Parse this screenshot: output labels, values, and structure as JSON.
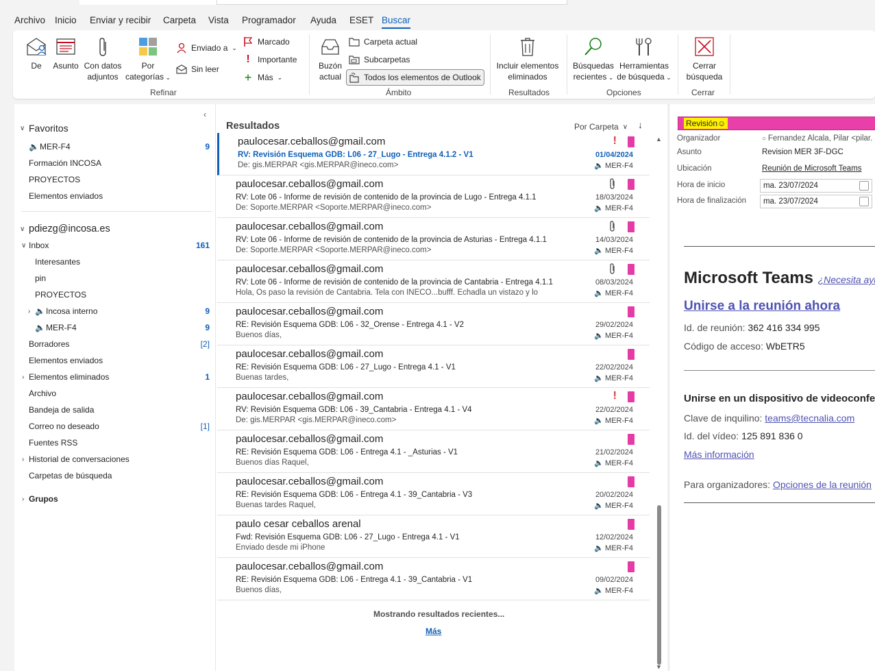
{
  "menu": {
    "tabs": [
      "Archivo",
      "Inicio",
      "Enviar y recibir",
      "Carpeta",
      "Vista",
      "Programador",
      "Ayuda",
      "ESET",
      "Buscar"
    ]
  },
  "ribbon": {
    "from_label": "De",
    "subject_label": "Asunto",
    "attachments_label": "Con datos adjuntos",
    "categories_label": "Por categorías",
    "sent_to_label": "Enviado a",
    "unread_label": "Sin leer",
    "flagged_label": "Marcado",
    "important_label": "Importante",
    "more_label": "Más",
    "refine_group": "Refinar",
    "current_mailbox_label": "Buzón actual",
    "current_folder_label": "Carpeta actual",
    "subfolders_label": "Subcarpetas",
    "all_outlook_label": "Todos los elementos de Outlook",
    "scope_group": "Ámbito",
    "include_deleted_label": "Incluir elementos eliminados",
    "results_group": "Resultados",
    "recent_searches_label": "Búsquedas recientes",
    "search_tools_label": "Herramientas de búsqueda",
    "options_group": "Opciones",
    "close_search_label": "Cerrar búsqueda",
    "close_group": "Cerrar"
  },
  "nav": {
    "favorites_header": "Favoritos",
    "favorites": [
      {
        "label": "MER-F4",
        "count": "9"
      },
      {
        "label": "Formación INCOSA",
        "count": ""
      },
      {
        "label": "PROYECTOS",
        "count": ""
      },
      {
        "label": "Elementos enviados",
        "count": ""
      }
    ],
    "account": "pdiezg@incosa.es",
    "inbox": {
      "label": "Inbox",
      "count": "161"
    },
    "inbox_children": [
      {
        "label": "Interesantes",
        "count": ""
      },
      {
        "label": "pin",
        "count": ""
      },
      {
        "label": "PROYECTOS",
        "count": ""
      },
      {
        "label": "Incosa interno",
        "count": "9"
      },
      {
        "label": "MER-F4",
        "count": "9"
      }
    ],
    "folders": [
      {
        "label": "Borradores",
        "count": "[2]"
      },
      {
        "label": "Elementos enviados",
        "count": ""
      },
      {
        "label": "Elementos eliminados",
        "count": "1"
      },
      {
        "label": "Archivo",
        "count": ""
      },
      {
        "label": "Bandeja de salida",
        "count": ""
      },
      {
        "label": "Correo no deseado",
        "count": "[1]"
      },
      {
        "label": "Fuentes RSS",
        "count": ""
      },
      {
        "label": "Historial de conversaciones",
        "count": ""
      },
      {
        "label": "Carpetas de búsqueda",
        "count": ""
      }
    ],
    "groups": "Grupos"
  },
  "list": {
    "header": "Resultados",
    "sort_label": "Por Carpeta",
    "messages": [
      {
        "from": "paulocesar.ceballos@gmail.com",
        "subject": "RV: Revisión Esquema GDB: L06 - 27_Lugo - Entrega 4.1.2 - V1",
        "preview": "De: gis.MERPAR <gis.MERPAR@ineco.com>",
        "date": "01/04/2024",
        "folder": "MER-F4",
        "flag": "!",
        "clip": false
      },
      {
        "from": "paulocesar.ceballos@gmail.com",
        "subject": "RV: Lote 06 - Informe de revisión de contenido de la provincia de Lugo - Entrega 4.1.1",
        "preview": "De: Soporte.MERPAR <Soporte.MERPAR@ineco.com>",
        "date": "18/03/2024",
        "folder": "MER-F4",
        "flag": "",
        "clip": true
      },
      {
        "from": "paulocesar.ceballos@gmail.com",
        "subject": "RV: Lote 06 - Informe de revisión de contenido de la provincia de Asturias - Entrega 4.1.1",
        "preview": "De: Soporte.MERPAR <Soporte.MERPAR@ineco.com>",
        "date": "14/03/2024",
        "folder": "MER-F4",
        "flag": "",
        "clip": true
      },
      {
        "from": "paulocesar.ceballos@gmail.com",
        "subject": "RV: Lote 06 - Informe de revisión de contenido de la provincia de Cantabria - Entrega 4.1.1",
        "preview": "Hola,  Os paso la revisión de Cantabria. Tela con INECO...bufff. Echadla un vistazo y lo",
        "date": "08/03/2024",
        "folder": "MER-F4",
        "flag": "",
        "clip": true
      },
      {
        "from": "paulocesar.ceballos@gmail.com",
        "subject": "RE: Revisión Esquema GDB: L06 - 32_Orense - Entrega 4.1 - V2",
        "preview": "Buenos días,",
        "date": "29/02/2024",
        "folder": "MER-F4",
        "flag": "",
        "clip": false
      },
      {
        "from": "paulocesar.ceballos@gmail.com",
        "subject": "RE: Revisión Esquema GDB: L06 - 27_Lugo - Entrega 4.1 - V1",
        "preview": "Buenas tardes,",
        "date": "22/02/2024",
        "folder": "MER-F4",
        "flag": "",
        "clip": false
      },
      {
        "from": "paulocesar.ceballos@gmail.com",
        "subject": "RV: Revisión Esquema GDB: L06 - 39_Cantabria - Entrega 4.1 - V4",
        "preview": "De: gis.MERPAR <gis.MERPAR@ineco.com>",
        "date": "22/02/2024",
        "folder": "MER-F4",
        "flag": "!",
        "clip": false
      },
      {
        "from": "paulocesar.ceballos@gmail.com",
        "subject": "RE: Revisión Esquema GDB: L06 - Entrega 4.1 - _Asturias - V1",
        "preview": "Buenos días Raquel,",
        "date": "21/02/2024",
        "folder": "MER-F4",
        "flag": "",
        "clip": false
      },
      {
        "from": "paulocesar.ceballos@gmail.com",
        "subject": "RE: Revisión Esquema GDB: L06 - Entrega 4.1 - 39_Cantabria - V3",
        "preview": "Buenas tardes Raquel,",
        "date": "20/02/2024",
        "folder": "MER-F4",
        "flag": "",
        "clip": false
      },
      {
        "from": "paulo cesar ceballos arenal",
        "subject": "Fwd: Revisión Esquema GDB: L06 - 27_Lugo - Entrega 4.1 - V1",
        "preview": "Enviado desde mi iPhone",
        "date": "12/02/2024",
        "folder": "MER-F4",
        "flag": "",
        "clip": false
      },
      {
        "from": "paulocesar.ceballos@gmail.com",
        "subject": "RE: Revisión Esquema GDB: L06 - Entrega 4.1 - 39_Cantabria - V1",
        "preview": "Buenos días,",
        "date": "09/02/2024",
        "folder": "MER-F4",
        "flag": "",
        "clip": false
      }
    ],
    "showing": "Mostrando resultados recientes...",
    "more": "Más"
  },
  "reading": {
    "category": "Revisión",
    "organizer_label": "Organizador",
    "organizer": "Fernandez Alcala, Pilar <pilar.",
    "subject_label": "Asunto",
    "subject": "Revision MER 3F-DGC",
    "location_label": "Ubicación",
    "location": "Reunión de Microsoft Teams",
    "start_label": "Hora de inicio",
    "start": "ma. 23/07/2024",
    "end_label": "Hora de finalización",
    "end": "ma. 23/07/2024",
    "teams_title": "Microsoft Teams",
    "teams_help": "¿Necesita ayuda?",
    "join_now": "Unirse a la reunión ahora",
    "meeting_id_label": "Id. de reunión:",
    "meeting_id": "362 416 334 995",
    "passcode_label": "Código de acceso:",
    "passcode": "WbETR5",
    "video_heading": "Unirse en un dispositivo de videoconferencia",
    "tenant_label": "Clave de inquilino:",
    "tenant": "teams@tecnalia.com",
    "video_id_label": "Id. del vídeo:",
    "video_id": "125 891 836 0",
    "more_info": "Más información",
    "organizers_label": "Para organizadores:",
    "meeting_options": "Opciones de la reunión"
  },
  "colors": {
    "accent": "#0f5fb8",
    "category_pink": "#e840a8",
    "flag_red": "#d13438",
    "teams_purple": "#4f52b2"
  }
}
